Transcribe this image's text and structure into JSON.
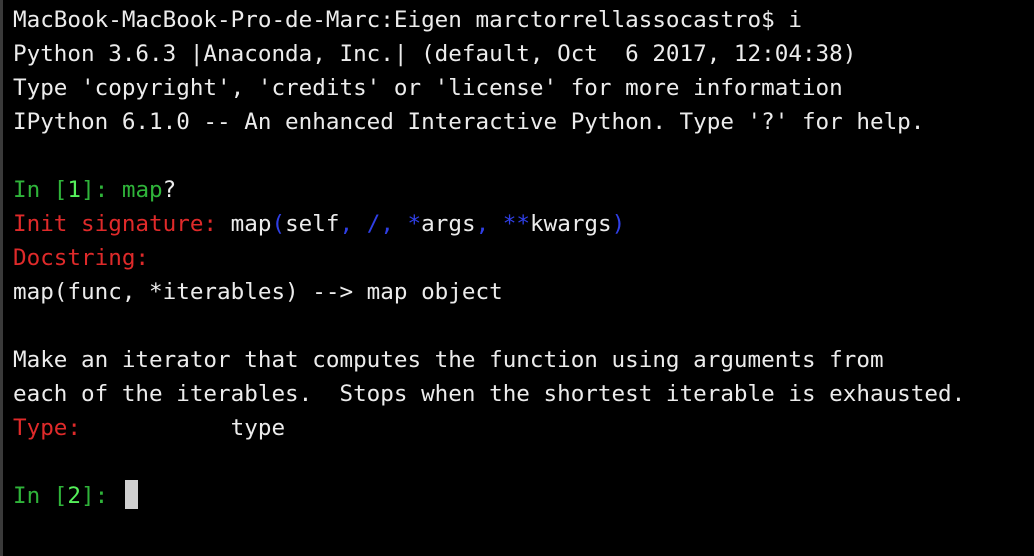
{
  "terminal": {
    "shell_prompt": "MacBook-MacBook-Pro-de-Marc:Eigen marctorrellassocastro$ ",
    "shell_command": "i",
    "banner": [
      "Python 3.6.3 |Anaconda, Inc.| (default, Oct  6 2017, 12:04:38)",
      "Type 'copyright', 'credits' or 'license' for more information",
      "IPython 6.1.0 -- An enhanced Interactive Python. Type '?' for help."
    ],
    "cell1": {
      "prompt_in": "In [",
      "number": "1",
      "prompt_close": "]: ",
      "input": "map",
      "suffix": "?"
    },
    "help": {
      "init_signature_label": "Init signature:",
      "sig_name": "map",
      "sig_open": "(",
      "sig_self": "self",
      "sig_comma1": ", ",
      "sig_slash": "/",
      "sig_comma2": ", ",
      "sig_star": "*",
      "sig_args": "args",
      "sig_comma3": ", ",
      "sig_dstar": "**",
      "sig_kwargs": "kwargs",
      "sig_close": ")",
      "docstring_label": "Docstring:",
      "doc_lines": [
        "map(func, *iterables) --> map object",
        "",
        "Make an iterator that computes the function using arguments from",
        "each of the iterables.  Stops when the shortest iterable is exhausted."
      ],
      "type_label": "Type:",
      "type_value": "type"
    },
    "cell2": {
      "prompt_in": "In [",
      "number": "2",
      "prompt_close": "]: "
    }
  },
  "colors": {
    "background": "#000000",
    "text": "#ececec",
    "prompt_green": "#2fb43a",
    "prompt_number_green": "#55f05a",
    "label_red": "#df2a2a",
    "keyword_blue": "#2f3fe6",
    "cursor": "#d0d0d0"
  }
}
